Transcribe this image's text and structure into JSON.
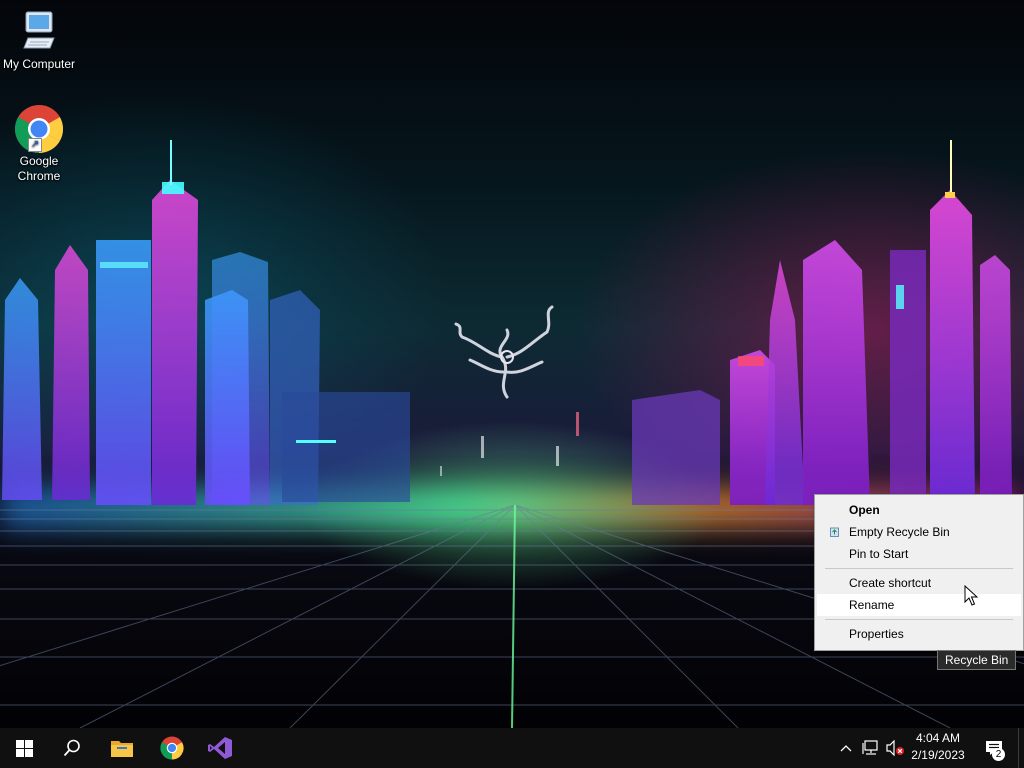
{
  "desktop": {
    "icons": [
      {
        "label": "My Computer",
        "icon": "computer-icon"
      },
      {
        "label": "Google Chrome",
        "icon": "chrome-icon"
      }
    ]
  },
  "context_menu": {
    "items": [
      {
        "label": "Open",
        "bold": true
      },
      {
        "label": "Empty Recycle Bin",
        "icon": "recycle-bin-icon"
      },
      {
        "label": "Pin to Start"
      },
      {
        "label": "Create shortcut"
      },
      {
        "label": "Rename",
        "highlighted": true
      },
      {
        "label": "Properties"
      }
    ]
  },
  "tooltip": {
    "text": "Recycle Bin"
  },
  "taskbar": {
    "pinned": [
      "windows-start-icon",
      "search-icon",
      "file-explorer-icon",
      "chrome-icon",
      "visual-studio-icon"
    ],
    "clock": {
      "time": "4:04 AM",
      "date": "2/19/2023"
    },
    "notifications": {
      "count": "2"
    }
  },
  "colors": {
    "taskbar": "#101010",
    "menu_bg": "#f0f0f0",
    "accent_purple": "#c43cff",
    "accent_cyan": "#2fd4ff"
  }
}
